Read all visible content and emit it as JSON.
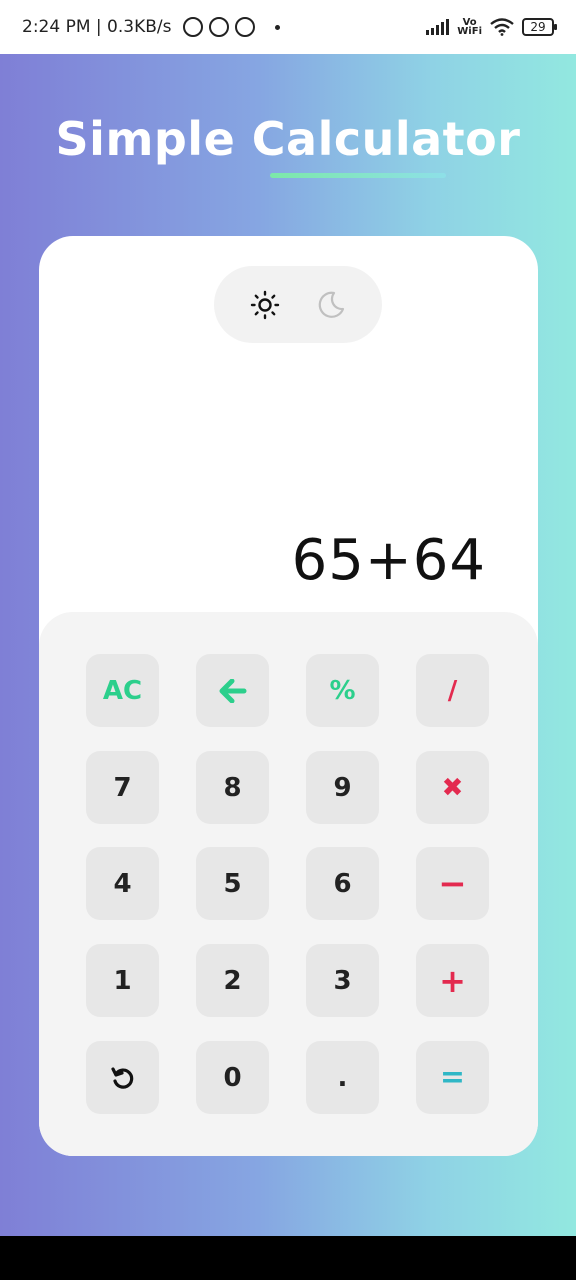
{
  "status_bar": {
    "time_speed": "2:24 PM | 0.3KB/s",
    "network_label_top": "Vo",
    "network_label_bottom": "WiFi",
    "battery": "29"
  },
  "app": {
    "title": "Simple Calculator",
    "accent_colors": {
      "green": "#2ccf8c",
      "red": "#e32a4f",
      "teal": "#2fb7c6"
    },
    "theme_toggle": {
      "light_icon": "sun-icon",
      "dark_icon": "moon-icon"
    },
    "display": {
      "expression": "65+64"
    },
    "keys": {
      "ac": "AC",
      "back": "←",
      "percent": "%",
      "divide": "/",
      "k7": "7",
      "k8": "8",
      "k9": "9",
      "multiply": "✖",
      "k4": "4",
      "k5": "5",
      "k6": "6",
      "minus": "−",
      "k1": "1",
      "k2": "2",
      "k3": "3",
      "plus": "+",
      "k0": "0",
      "dot": ".",
      "equals": "="
    }
  }
}
